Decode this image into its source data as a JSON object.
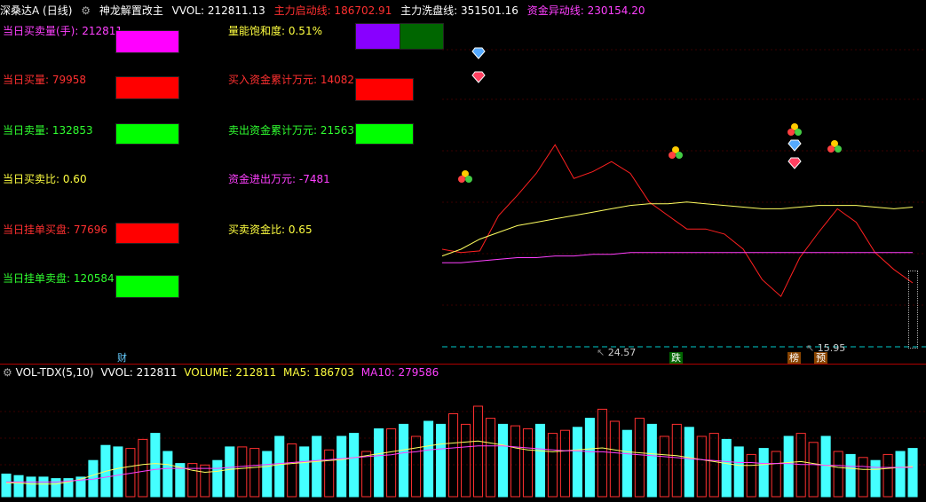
{
  "header": {
    "stock": "深桑达A (日线)",
    "indicator_name": "神龙解置改主",
    "vwol": "VVOL: 212811.13",
    "startup_line": "主力启动线: 186702.91",
    "wash_line": "主力洗盘线: 351501.16",
    "fund_line": "资金异动线: 230154.20",
    "colors": {
      "stock": "#ffffff",
      "vwol": "#ffffff",
      "startup": "#ff3030",
      "wash": "#ffffff",
      "fund": "#ff40ff"
    }
  },
  "stats_left": [
    {
      "label": "当日买卖量(手): 212811",
      "color": "#ff40ff",
      "box": "#ff00ff"
    },
    {
      "label": "当日买量: 79958",
      "color": "#ff3030",
      "box": "#ff0000"
    },
    {
      "label": "当日卖量: 132853",
      "color": "#30ff30",
      "box": "#00ff00"
    },
    {
      "label": "当日买卖比: 0.60",
      "color": "#ffff40",
      "box": ""
    },
    {
      "label": "当日挂单买盘: 77696",
      "color": "#ff3030",
      "box": "#ff0000"
    },
    {
      "label": "当日挂单卖盘: 120584",
      "color": "#30ff30",
      "box": "#00ff00"
    }
  ],
  "stats_right": [
    {
      "label": "量能饱和度: 0.51%",
      "color": "#ffff40"
    },
    {
      "label": "买入资金累计万元: 14082",
      "color": "#ff3030",
      "box": "#ff0000"
    },
    {
      "label": "卖出资金累计万元: 21563",
      "color": "#30ff30",
      "box": "#00ff00"
    },
    {
      "label": "资金进出万元: -7481",
      "color": "#ff40ff"
    },
    {
      "label": "买卖资金比: 0.65",
      "color": "#ffff40"
    }
  ],
  "saturation_colors": [
    "#8800ff",
    "#006600"
  ],
  "price_low_label": "24.57",
  "price_mark_label": "15.95",
  "markers": {
    "cai": "财",
    "die": "跌",
    "bang": "榜",
    "yu": "预"
  },
  "vol_header": {
    "name": "VOL-TDX(5,10)",
    "vvol": "VVOL: 212811",
    "volume": "VOLUME: 212811",
    "ma5": "MA5: 186703",
    "ma10": "MA10: 279586"
  },
  "chart_data": [
    {
      "type": "line",
      "title": "",
      "series": [
        {
          "name": "主力启动线",
          "color": "#ff2020",
          "values": [
            0.1,
            0.08,
            0.09,
            0.3,
            0.42,
            0.55,
            0.72,
            0.52,
            0.56,
            0.62,
            0.55,
            0.38,
            0.3,
            0.22,
            0.22,
            0.19,
            0.1,
            -0.08,
            -0.18,
            0.05,
            0.2,
            0.34,
            0.26,
            0.08,
            -0.02,
            -0.1
          ]
        },
        {
          "name": "主力洗盘线",
          "color": "#ffff60",
          "values": [
            0.06,
            0.1,
            0.16,
            0.2,
            0.24,
            0.26,
            0.28,
            0.3,
            0.32,
            0.34,
            0.36,
            0.37,
            0.37,
            0.38,
            0.37,
            0.36,
            0.35,
            0.34,
            0.34,
            0.35,
            0.36,
            0.36,
            0.36,
            0.35,
            0.34,
            0.35
          ]
        },
        {
          "name": "资金异动线",
          "color": "#ff40ff",
          "values": [
            0.02,
            0.02,
            0.03,
            0.04,
            0.05,
            0.05,
            0.06,
            0.06,
            0.07,
            0.07,
            0.08,
            0.08,
            0.08,
            0.08,
            0.08,
            0.08,
            0.08,
            0.08,
            0.08,
            0.08,
            0.08,
            0.08,
            0.08,
            0.08,
            0.08,
            0.08
          ]
        }
      ]
    },
    {
      "type": "bar",
      "title": "",
      "values": [
        15,
        14,
        13,
        13,
        12,
        12,
        13,
        24,
        34,
        33,
        32,
        38,
        42,
        30,
        22,
        22,
        21,
        24,
        33,
        33,
        32,
        30,
        40,
        35,
        33,
        40,
        31,
        40,
        42,
        30,
        45,
        45,
        48,
        40,
        50,
        48,
        55,
        48,
        60,
        52,
        48,
        47,
        45,
        48,
        42,
        44,
        46,
        52,
        58,
        50,
        44,
        52,
        48,
        40,
        48,
        46,
        40,
        42,
        38,
        33,
        28,
        32,
        30,
        40,
        42,
        36,
        40,
        30,
        28,
        26,
        24,
        28,
        30,
        32
      ],
      "up": [
        false,
        false,
        false,
        false,
        false,
        false,
        false,
        false,
        false,
        false,
        true,
        true,
        false,
        false,
        false,
        true,
        true,
        false,
        false,
        true,
        true,
        false,
        false,
        true,
        false,
        false,
        true,
        false,
        false,
        true,
        false,
        true,
        false,
        true,
        false,
        false,
        true,
        true,
        true,
        true,
        false,
        true,
        true,
        false,
        true,
        true,
        false,
        false,
        true,
        true,
        false,
        true,
        false,
        true,
        true,
        false,
        true,
        true,
        false,
        false,
        true,
        false,
        true,
        false,
        true,
        true,
        false,
        true,
        false,
        true,
        false,
        true,
        false,
        false
      ],
      "ma5": [
        0.14,
        0.14,
        0.13,
        0.13,
        0.13,
        0.15,
        0.18,
        0.22,
        0.26,
        0.29,
        0.31,
        0.33,
        0.34,
        0.33,
        0.3,
        0.27,
        0.25,
        0.26,
        0.28,
        0.29,
        0.3,
        0.31,
        0.33,
        0.34,
        0.35,
        0.36,
        0.37,
        0.38,
        0.4,
        0.42,
        0.44,
        0.46,
        0.48,
        0.5,
        0.52,
        0.54,
        0.55,
        0.56,
        0.57,
        0.55,
        0.53,
        0.5,
        0.48,
        0.47,
        0.46,
        0.47,
        0.48,
        0.49,
        0.5,
        0.48,
        0.46,
        0.45,
        0.44,
        0.43,
        0.42,
        0.4,
        0.38,
        0.36,
        0.34,
        0.32,
        0.32,
        0.33,
        0.34,
        0.35,
        0.36,
        0.34,
        0.32,
        0.3,
        0.29,
        0.28,
        0.28,
        0.29,
        0.3,
        0.31
      ],
      "ma10": [
        0.15,
        0.15,
        0.15,
        0.15,
        0.15,
        0.16,
        0.17,
        0.18,
        0.2,
        0.22,
        0.24,
        0.26,
        0.28,
        0.29,
        0.29,
        0.29,
        0.29,
        0.29,
        0.3,
        0.31,
        0.32,
        0.33,
        0.34,
        0.35,
        0.36,
        0.37,
        0.38,
        0.39,
        0.4,
        0.41,
        0.42,
        0.43,
        0.45,
        0.46,
        0.48,
        0.49,
        0.5,
        0.51,
        0.52,
        0.52,
        0.52,
        0.51,
        0.5,
        0.49,
        0.48,
        0.47,
        0.47,
        0.46,
        0.46,
        0.45,
        0.44,
        0.43,
        0.42,
        0.41,
        0.4,
        0.39,
        0.38,
        0.37,
        0.36,
        0.35,
        0.35,
        0.34,
        0.34,
        0.34,
        0.33,
        0.33,
        0.32,
        0.32,
        0.31,
        0.31,
        0.3,
        0.3,
        0.3,
        0.3
      ]
    }
  ]
}
